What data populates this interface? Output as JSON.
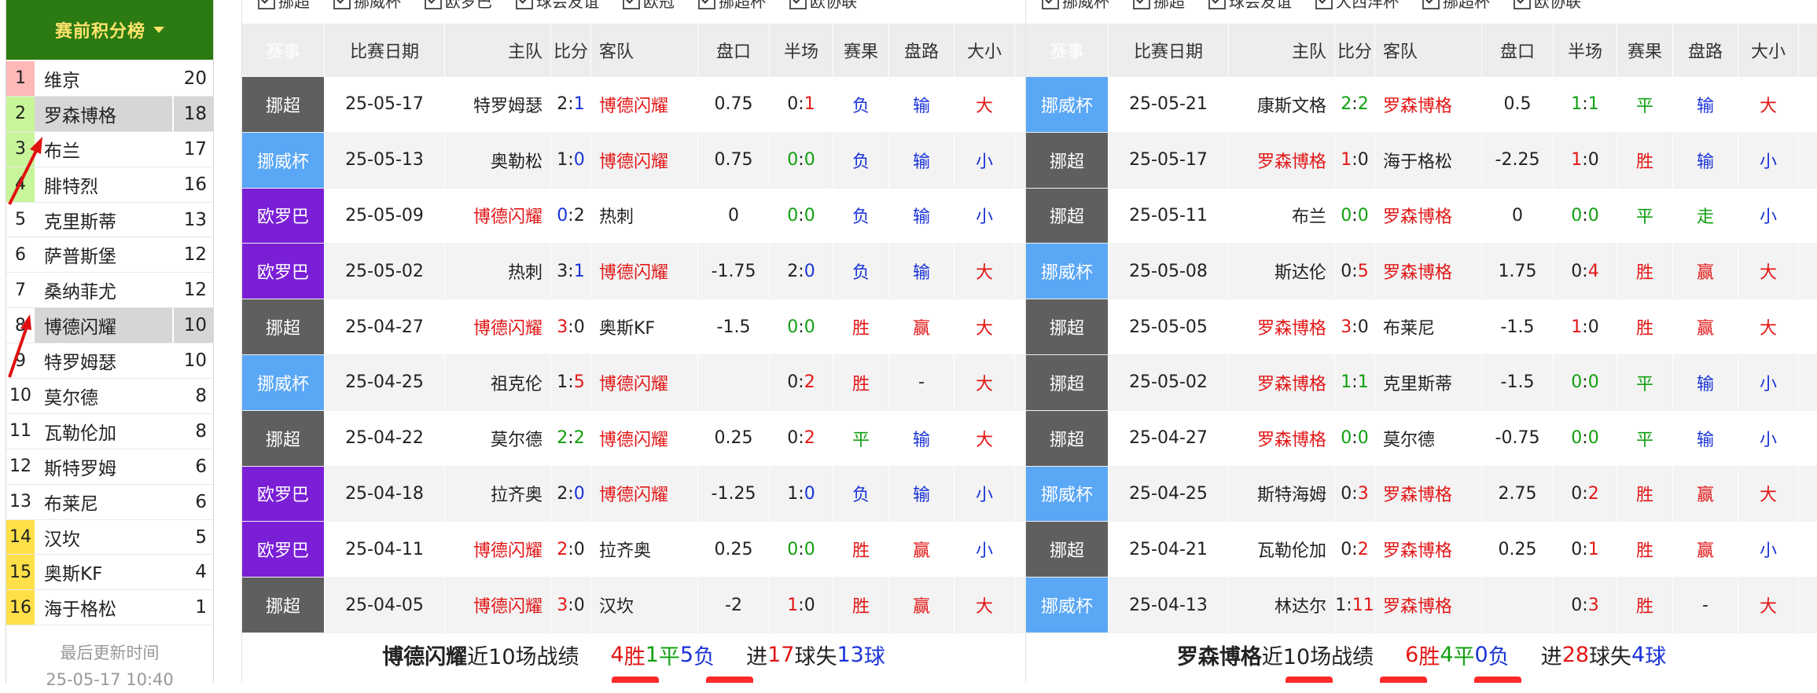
{
  "sidebar": {
    "title": "赛前积分榜",
    "rows": [
      {
        "rank": "1",
        "team": "维京",
        "pts": "20",
        "rank_color": "red",
        "hl": false
      },
      {
        "rank": "2",
        "team": "罗森博格",
        "pts": "18",
        "rank_color": "green",
        "hl": true
      },
      {
        "rank": "3",
        "team": "布兰",
        "pts": "17",
        "rank_color": "green",
        "hl": false
      },
      {
        "rank": "4",
        "team": "腓特烈",
        "pts": "16",
        "rank_color": "green",
        "hl": false
      },
      {
        "rank": "5",
        "team": "克里斯蒂",
        "pts": "13",
        "rank_color": "",
        "hl": false
      },
      {
        "rank": "6",
        "team": "萨普斯堡",
        "pts": "12",
        "rank_color": "",
        "hl": false
      },
      {
        "rank": "7",
        "team": "桑纳菲尤",
        "pts": "12",
        "rank_color": "",
        "hl": false
      },
      {
        "rank": "8",
        "team": "博德闪耀",
        "pts": "10",
        "rank_color": "",
        "hl": true
      },
      {
        "rank": "9",
        "team": "特罗姆瑟",
        "pts": "10",
        "rank_color": "",
        "hl": false
      },
      {
        "rank": "10",
        "team": "莫尔德",
        "pts": "8",
        "rank_color": "",
        "hl": false
      },
      {
        "rank": "11",
        "team": "瓦勒伦加",
        "pts": "8",
        "rank_color": "",
        "hl": false
      },
      {
        "rank": "12",
        "team": "斯特罗姆",
        "pts": "6",
        "rank_color": "",
        "hl": false
      },
      {
        "rank": "13",
        "team": "布莱尼",
        "pts": "6",
        "rank_color": "",
        "hl": false
      },
      {
        "rank": "14",
        "team": "汉坎",
        "pts": "5",
        "rank_color": "yellow",
        "hl": false
      },
      {
        "rank": "15",
        "team": "奥斯KF",
        "pts": "4",
        "rank_color": "yellow",
        "hl": false
      },
      {
        "rank": "16",
        "team": "海于格松",
        "pts": "1",
        "rank_color": "yellow",
        "hl": false
      }
    ],
    "update_label": "最后更新时间",
    "update_time": "25-05-17 10:40"
  },
  "headers": [
    "赛事",
    "比赛日期",
    "主队",
    "比分",
    "客队",
    "盘口",
    "半场",
    "赛果",
    "盘路",
    "大小"
  ],
  "left": {
    "filters": [
      "挪超",
      "挪威杯",
      "欧罗巴",
      "球会友谊",
      "欧冠",
      "挪超杯",
      "欧协联"
    ],
    "rows": [
      {
        "event": "挪超",
        "ev": "chao",
        "date": "25-05-17",
        "home": "特罗姆瑟",
        "home_c": "black",
        "s1": "2",
        "s1_c": "black",
        "s2": "1",
        "s2_c": "blue",
        "away": "博德闪耀",
        "away_c": "red",
        "line": "0.75",
        "h1": "0",
        "h1_c": "black",
        "h2": "1",
        "h2_c": "red",
        "res": "负",
        "res_c": "blue",
        "pan": "输",
        "pan_c": "blue",
        "ou": "大",
        "ou_c": "red"
      },
      {
        "event": "挪威杯",
        "ev": "bei",
        "date": "25-05-13",
        "home": "奥勒松",
        "home_c": "black",
        "s1": "1",
        "s1_c": "black",
        "s2": "0",
        "s2_c": "blue",
        "away": "博德闪耀",
        "away_c": "red",
        "line": "0.75",
        "h1": "0",
        "h1_c": "green",
        "h2": "0",
        "h2_c": "green",
        "res": "负",
        "res_c": "blue",
        "pan": "输",
        "pan_c": "blue",
        "ou": "小",
        "ou_c": "blue"
      },
      {
        "event": "欧罗巴",
        "ev": "ouluoba",
        "date": "25-05-09",
        "home": "博德闪耀",
        "home_c": "red",
        "s1": "0",
        "s1_c": "blue",
        "s2": "2",
        "s2_c": "black",
        "away": "热刺",
        "away_c": "black",
        "line": "0",
        "h1": "0",
        "h1_c": "green",
        "h2": "0",
        "h2_c": "green",
        "res": "负",
        "res_c": "blue",
        "pan": "输",
        "pan_c": "blue",
        "ou": "小",
        "ou_c": "blue"
      },
      {
        "event": "欧罗巴",
        "ev": "ouluoba",
        "date": "25-05-02",
        "home": "热刺",
        "home_c": "black",
        "s1": "3",
        "s1_c": "black",
        "s2": "1",
        "s2_c": "blue",
        "away": "博德闪耀",
        "away_c": "red",
        "line": "-1.75",
        "h1": "2",
        "h1_c": "black",
        "h2": "0",
        "h2_c": "blue",
        "res": "负",
        "res_c": "blue",
        "pan": "输",
        "pan_c": "blue",
        "ou": "大",
        "ou_c": "red"
      },
      {
        "event": "挪超",
        "ev": "chao",
        "date": "25-04-27",
        "home": "博德闪耀",
        "home_c": "red",
        "s1": "3",
        "s1_c": "red",
        "s2": "0",
        "s2_c": "black",
        "away": "奥斯KF",
        "away_c": "black",
        "line": "-1.5",
        "h1": "0",
        "h1_c": "green",
        "h2": "0",
        "h2_c": "green",
        "res": "胜",
        "res_c": "red",
        "pan": "赢",
        "pan_c": "red",
        "ou": "大",
        "ou_c": "red"
      },
      {
        "event": "挪威杯",
        "ev": "bei",
        "date": "25-04-25",
        "home": "祖克伦",
        "home_c": "black",
        "s1": "1",
        "s1_c": "black",
        "s2": "5",
        "s2_c": "red",
        "away": "博德闪耀",
        "away_c": "red",
        "line": "",
        "h1": "0",
        "h1_c": "black",
        "h2": "2",
        "h2_c": "red",
        "res": "胜",
        "res_c": "red",
        "pan": "-",
        "pan_c": "black",
        "ou": "大",
        "ou_c": "red"
      },
      {
        "event": "挪超",
        "ev": "chao",
        "date": "25-04-22",
        "home": "莫尔德",
        "home_c": "black",
        "s1": "2",
        "s1_c": "green",
        "s2": "2",
        "s2_c": "green",
        "away": "博德闪耀",
        "away_c": "red",
        "line": "0.25",
        "h1": "0",
        "h1_c": "black",
        "h2": "2",
        "h2_c": "red",
        "res": "平",
        "res_c": "green",
        "pan": "输",
        "pan_c": "blue",
        "ou": "大",
        "ou_c": "red"
      },
      {
        "event": "欧罗巴",
        "ev": "ouluoba",
        "date": "25-04-18",
        "home": "拉齐奥",
        "home_c": "black",
        "s1": "2",
        "s1_c": "black",
        "s2": "0",
        "s2_c": "blue",
        "away": "博德闪耀",
        "away_c": "red",
        "line": "-1.25",
        "h1": "1",
        "h1_c": "black",
        "h2": "0",
        "h2_c": "blue",
        "res": "负",
        "res_c": "blue",
        "pan": "输",
        "pan_c": "blue",
        "ou": "小",
        "ou_c": "blue"
      },
      {
        "event": "欧罗巴",
        "ev": "ouluoba",
        "date": "25-04-11",
        "home": "博德闪耀",
        "home_c": "red",
        "s1": "2",
        "s1_c": "red",
        "s2": "0",
        "s2_c": "black",
        "away": "拉齐奥",
        "away_c": "black",
        "line": "0.25",
        "h1": "0",
        "h1_c": "green",
        "h2": "0",
        "h2_c": "green",
        "res": "胜",
        "res_c": "red",
        "pan": "赢",
        "pan_c": "red",
        "ou": "小",
        "ou_c": "blue"
      },
      {
        "event": "挪超",
        "ev": "chao",
        "date": "25-04-05",
        "home": "博德闪耀",
        "home_c": "red",
        "s1": "3",
        "s1_c": "red",
        "s2": "0",
        "s2_c": "black",
        "away": "汉坎",
        "away_c": "black",
        "line": "-2",
        "h1": "1",
        "h1_c": "red",
        "h2": "0",
        "h2_c": "black",
        "res": "胜",
        "res_c": "red",
        "pan": "赢",
        "pan_c": "red",
        "ou": "大",
        "ou_c": "red"
      }
    ],
    "summary": {
      "team": "博德闪耀",
      "label": "近10场战绩",
      "w": "4",
      "w_label": "胜",
      "d": "1",
      "d_label": "平",
      "l": "5",
      "l_label": "负",
      "gf_label": "进",
      "gf": "17",
      "ga_label": "球失",
      "ga": "13",
      "ga_tail": "球"
    }
  },
  "right": {
    "filters": [
      "挪威杯",
      "挪超",
      "球会友谊",
      "大西洋杯",
      "挪超杯",
      "欧协联"
    ],
    "rows": [
      {
        "event": "挪威杯",
        "ev": "bei",
        "date": "25-05-21",
        "home": "康斯文格",
        "home_c": "black",
        "s1": "2",
        "s1_c": "green",
        "s2": "2",
        "s2_c": "green",
        "away": "罗森博格",
        "away_c": "red",
        "line": "0.5",
        "h1": "1",
        "h1_c": "green",
        "h2": "1",
        "h2_c": "green",
        "res": "平",
        "res_c": "green",
        "pan": "输",
        "pan_c": "blue",
        "ou": "大",
        "ou_c": "red"
      },
      {
        "event": "挪超",
        "ev": "chao",
        "date": "25-05-17",
        "home": "罗森博格",
        "home_c": "red",
        "s1": "1",
        "s1_c": "red",
        "s2": "0",
        "s2_c": "black",
        "away": "海于格松",
        "away_c": "black",
        "line": "-2.25",
        "h1": "1",
        "h1_c": "red",
        "h2": "0",
        "h2_c": "black",
        "res": "胜",
        "res_c": "red",
        "pan": "输",
        "pan_c": "blue",
        "ou": "小",
        "ou_c": "blue"
      },
      {
        "event": "挪超",
        "ev": "chao",
        "date": "25-05-11",
        "home": "布兰",
        "home_c": "black",
        "s1": "0",
        "s1_c": "green",
        "s2": "0",
        "s2_c": "green",
        "away": "罗森博格",
        "away_c": "red",
        "line": "0",
        "h1": "0",
        "h1_c": "green",
        "h2": "0",
        "h2_c": "green",
        "res": "平",
        "res_c": "green",
        "pan": "走",
        "pan_c": "green",
        "ou": "小",
        "ou_c": "blue"
      },
      {
        "event": "挪威杯",
        "ev": "bei",
        "date": "25-05-08",
        "home": "斯达伦",
        "home_c": "black",
        "s1": "0",
        "s1_c": "black",
        "s2": "5",
        "s2_c": "red",
        "away": "罗森博格",
        "away_c": "red",
        "line": "1.75",
        "h1": "0",
        "h1_c": "black",
        "h2": "4",
        "h2_c": "red",
        "res": "胜",
        "res_c": "red",
        "pan": "赢",
        "pan_c": "red",
        "ou": "大",
        "ou_c": "red"
      },
      {
        "event": "挪超",
        "ev": "chao",
        "date": "25-05-05",
        "home": "罗森博格",
        "home_c": "red",
        "s1": "3",
        "s1_c": "red",
        "s2": "0",
        "s2_c": "black",
        "away": "布莱尼",
        "away_c": "black",
        "line": "-1.5",
        "h1": "1",
        "h1_c": "red",
        "h2": "0",
        "h2_c": "black",
        "res": "胜",
        "res_c": "red",
        "pan": "赢",
        "pan_c": "red",
        "ou": "大",
        "ou_c": "red"
      },
      {
        "event": "挪超",
        "ev": "chao",
        "date": "25-05-02",
        "home": "罗森博格",
        "home_c": "red",
        "s1": "1",
        "s1_c": "green",
        "s2": "1",
        "s2_c": "green",
        "away": "克里斯蒂",
        "away_c": "black",
        "line": "-1.5",
        "h1": "0",
        "h1_c": "green",
        "h2": "0",
        "h2_c": "green",
        "res": "平",
        "res_c": "green",
        "pan": "输",
        "pan_c": "blue",
        "ou": "小",
        "ou_c": "blue"
      },
      {
        "event": "挪超",
        "ev": "chao",
        "date": "25-04-27",
        "home": "罗森博格",
        "home_c": "red",
        "s1": "0",
        "s1_c": "green",
        "s2": "0",
        "s2_c": "green",
        "away": "莫尔德",
        "away_c": "black",
        "line": "-0.75",
        "h1": "0",
        "h1_c": "green",
        "h2": "0",
        "h2_c": "green",
        "res": "平",
        "res_c": "green",
        "pan": "输",
        "pan_c": "blue",
        "ou": "小",
        "ou_c": "blue"
      },
      {
        "event": "挪威杯",
        "ev": "bei",
        "date": "25-04-25",
        "home": "斯特海姆",
        "home_c": "black",
        "s1": "0",
        "s1_c": "black",
        "s2": "3",
        "s2_c": "red",
        "away": "罗森博格",
        "away_c": "red",
        "line": "2.75",
        "h1": "0",
        "h1_c": "black",
        "h2": "2",
        "h2_c": "red",
        "res": "胜",
        "res_c": "red",
        "pan": "赢",
        "pan_c": "red",
        "ou": "大",
        "ou_c": "red"
      },
      {
        "event": "挪超",
        "ev": "chao",
        "date": "25-04-21",
        "home": "瓦勒伦加",
        "home_c": "black",
        "s1": "0",
        "s1_c": "black",
        "s2": "2",
        "s2_c": "red",
        "away": "罗森博格",
        "away_c": "red",
        "line": "0.25",
        "h1": "0",
        "h1_c": "black",
        "h2": "1",
        "h2_c": "red",
        "res": "胜",
        "res_c": "red",
        "pan": "赢",
        "pan_c": "red",
        "ou": "小",
        "ou_c": "blue"
      },
      {
        "event": "挪威杯",
        "ev": "bei",
        "date": "25-04-13",
        "home": "林达尔",
        "home_c": "black",
        "s1": "1",
        "s1_c": "black",
        "s2": "11",
        "s2_c": "red",
        "away": "罗森博格",
        "away_c": "red",
        "line": "",
        "h1": "0",
        "h1_c": "black",
        "h2": "3",
        "h2_c": "red",
        "res": "胜",
        "res_c": "red",
        "pan": "-",
        "pan_c": "black",
        "ou": "大",
        "ou_c": "red"
      }
    ],
    "summary": {
      "team": "罗森博格",
      "label": "近10场战绩",
      "w": "6",
      "w_label": "胜",
      "d": "4",
      "d_label": "平",
      "l": "0",
      "l_label": "负",
      "gf_label": "进",
      "gf": "28",
      "ga_label": "球失",
      "ga": "4",
      "ga_tail": "球"
    }
  }
}
